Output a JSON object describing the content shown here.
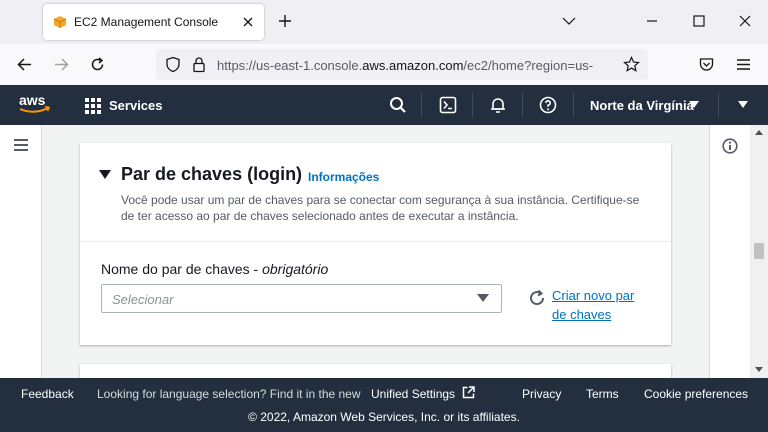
{
  "browser": {
    "tab_title": "EC2 Management Console",
    "url_prefix": "https://us-east-1.console.",
    "url_domain": "aws.amazon.com",
    "url_suffix": "/ec2/home?region=us-",
    "icons": [
      "cube-favicon-icon",
      "close-icon",
      "plus-icon",
      "chevron-down-icon",
      "minimize-icon",
      "maximize-icon",
      "close-window-icon",
      "back-icon",
      "forward-icon",
      "reload-icon",
      "shield-icon",
      "lock-icon",
      "star-icon",
      "pocket-icon",
      "hamburger-icon"
    ]
  },
  "aws_nav": {
    "logo": "aws",
    "services_label": "Services",
    "region_label": "Norte da Virgínia",
    "icons": [
      "grid-icon",
      "search-icon",
      "cloudshell-icon",
      "bell-icon",
      "help-icon",
      "caret-down-icon"
    ]
  },
  "card": {
    "title": "Par de chaves (login)",
    "info_link": "Informações",
    "description": "Você pode usar um par de chaves para se conectar com segurança à sua instância. Certifique-se de ter acesso ao par de chaves selecionado antes de executar a instância.",
    "field_label": "Nome do par de chaves",
    "field_label_sep": " - ",
    "field_required": "obrigatório",
    "select_placeholder": "Selecionar",
    "create_link": "Criar novo par de chaves"
  },
  "footer": {
    "feedback": "Feedback",
    "language_text": "Looking for language selection? Find it in the new",
    "unified_settings": "Unified Settings",
    "privacy": "Privacy",
    "terms": "Terms",
    "cookie_prefs": "Cookie preferences",
    "copyright": "© 2022, Amazon Web Services, Inc. or its affiliates."
  },
  "colors": {
    "aws_nav_bg": "#232f3e",
    "link": "#0073bb",
    "aws_orange": "#ff9900"
  }
}
